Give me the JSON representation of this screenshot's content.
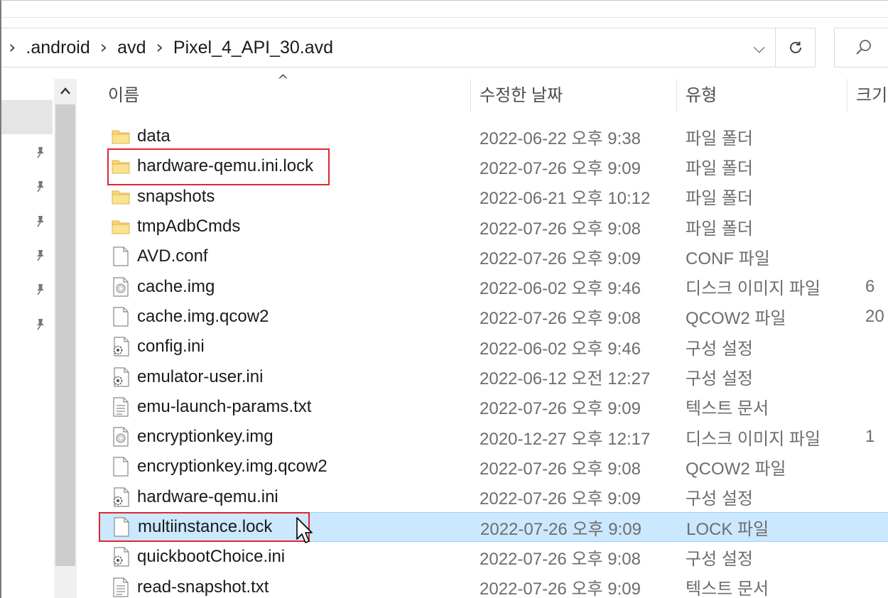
{
  "colors": {
    "highlight": "#e0262e",
    "selection": "#cce8ff",
    "folder": "#f8d775"
  },
  "breadcrumb": {
    "items": [
      ".android",
      "avd",
      "Pixel_4_API_30.avd"
    ]
  },
  "icons": {
    "refresh": "refresh-icon",
    "search": "search-icon",
    "pin": "pin-icon",
    "folder": "folder-icon",
    "file": "file-icon",
    "settings_file": "settings-file-icon",
    "disc_image": "disc-image-icon",
    "text_file": "text-file-icon"
  },
  "columns": {
    "name": "이름",
    "date": "수정한 날짜",
    "type": "유형",
    "size": "크기"
  },
  "files": [
    {
      "name": "data",
      "date": "2022-06-22 오후 9:38",
      "type": "파일 폴더",
      "size": "",
      "icon": "folder"
    },
    {
      "name": "hardware-qemu.ini.lock",
      "date": "2022-07-26 오후 9:09",
      "type": "파일 폴더",
      "size": "",
      "icon": "folder"
    },
    {
      "name": "snapshots",
      "date": "2022-06-21 오후 10:12",
      "type": "파일 폴더",
      "size": "",
      "icon": "folder"
    },
    {
      "name": "tmpAdbCmds",
      "date": "2022-07-26 오후 9:08",
      "type": "파일 폴더",
      "size": "",
      "icon": "folder"
    },
    {
      "name": "AVD.conf",
      "date": "2022-07-26 오후 9:09",
      "type": "CONF 파일",
      "size": "",
      "icon": "file"
    },
    {
      "name": "cache.img",
      "date": "2022-06-02 오후 9:46",
      "type": "디스크 이미지 파일",
      "size": "6",
      "icon": "disc"
    },
    {
      "name": "cache.img.qcow2",
      "date": "2022-07-26 오후 9:08",
      "type": "QCOW2 파일",
      "size": "20",
      "icon": "file"
    },
    {
      "name": "config.ini",
      "date": "2022-06-02 오후 9:46",
      "type": "구성 설정",
      "size": "",
      "icon": "settings"
    },
    {
      "name": "emulator-user.ini",
      "date": "2022-06-12 오전 12:27",
      "type": "구성 설정",
      "size": "",
      "icon": "settings"
    },
    {
      "name": "emu-launch-params.txt",
      "date": "2022-07-26 오후 9:09",
      "type": "텍스트 문서",
      "size": "",
      "icon": "text"
    },
    {
      "name": "encryptionkey.img",
      "date": "2020-12-27 오후 12:17",
      "type": "디스크 이미지 파일",
      "size": "1",
      "icon": "disc"
    },
    {
      "name": "encryptionkey.img.qcow2",
      "date": "2022-07-26 오후 9:08",
      "type": "QCOW2 파일",
      "size": "",
      "icon": "file"
    },
    {
      "name": "hardware-qemu.ini",
      "date": "2022-07-26 오후 9:09",
      "type": "구성 설정",
      "size": "",
      "icon": "settings"
    },
    {
      "name": "multiinstance.lock",
      "date": "2022-07-26 오후 9:09",
      "type": "LOCK 파일",
      "size": "",
      "icon": "file",
      "selected": true
    },
    {
      "name": "quickbootChoice.ini",
      "date": "2022-07-26 오후 9:08",
      "type": "구성 설정",
      "size": "",
      "icon": "settings"
    },
    {
      "name": "read-snapshot.txt",
      "date": "2022-07-26 오후 9:09",
      "type": "텍스트 문서",
      "size": "",
      "icon": "text"
    }
  ]
}
